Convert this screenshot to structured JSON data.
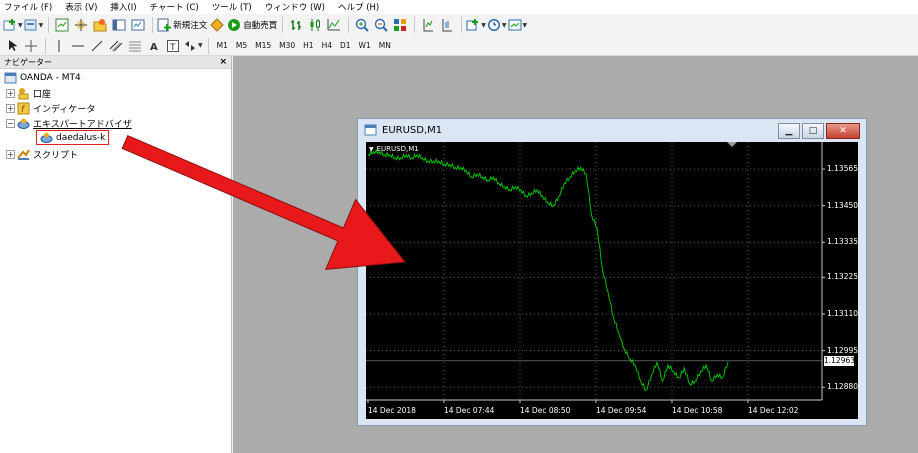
{
  "menubar": {
    "items": [
      "ファイル (F)",
      "表示 (V)",
      "挿入(I)",
      "チャート (C)",
      "ツール (T)",
      "ウィンドウ (W)",
      "ヘルプ (H)"
    ]
  },
  "toolbar": {
    "new_order_label": "新規注文",
    "auto_trading_label": "自動売買",
    "timeframes": [
      "M1",
      "M5",
      "M15",
      "M30",
      "H1",
      "H4",
      "D1",
      "W1",
      "MN"
    ]
  },
  "navigator": {
    "title": "ナビゲーター",
    "close_glyph": "×",
    "root": "OANDA - MT4",
    "accounts": "口座",
    "indicators": "インディケータ",
    "expert_advisors": "エキスパートアドバイザ",
    "expert_item": "daedalus-k",
    "scripts": "スクリプト"
  },
  "chart_window": {
    "title": "EURUSD,M1",
    "symbol_label": "EURUSD,M1",
    "current_price": "1.12963",
    "min_glyph": "▁",
    "max_glyph": "□",
    "close_glyph": "✕"
  },
  "colors": {
    "price_line": "#00c000",
    "grid": "#5a5a5a",
    "annotation_arrow": "#e8191b",
    "highlight_box": "#e02020"
  },
  "chart_data": {
    "type": "line",
    "title": "EURUSD,M1",
    "x_tick_labels": [
      "14 Dec 2018",
      "14 Dec 07:44",
      "14 Dec 08:50",
      "14 Dec 09:54",
      "14 Dec 10:58",
      "14 Dec 12:02"
    ],
    "y_tick_labels": [
      "1.13565",
      "1.13450",
      "1.13335",
      "1.13225",
      "1.13110",
      "1.12995",
      "1.12880"
    ],
    "ylim": [
      1.1284,
      1.1365
    ],
    "current_price": 1.12963,
    "grid": true,
    "series": [
      {
        "values": [
          1.1361,
          1.1362,
          1.1362,
          1.1361,
          1.1361,
          1.136,
          1.136,
          1.1361,
          1.136,
          1.1361,
          1.136,
          1.1359,
          1.1359,
          1.1359,
          1.1358,
          1.1358,
          1.1357,
          1.1357,
          1.1356,
          1.1354,
          1.1355,
          1.1354,
          1.1353,
          1.1354,
          1.1352,
          1.1351,
          1.135,
          1.1351,
          1.135,
          1.1348,
          1.1349,
          1.135,
          1.1348,
          1.1346,
          1.1345,
          1.1348,
          1.1352,
          1.1354,
          1.1356,
          1.1357,
          1.1355,
          1.1342,
          1.1338,
          1.1325,
          1.1318,
          1.131,
          1.1305,
          1.13,
          1.1297,
          1.1295,
          1.129,
          1.1287,
          1.1292,
          1.1296,
          1.129,
          1.1295,
          1.1293,
          1.1291,
          1.1294,
          1.1289,
          1.129,
          1.1293,
          1.1295,
          1.129,
          1.1292,
          1.1291,
          1.1296
        ]
      }
    ]
  }
}
